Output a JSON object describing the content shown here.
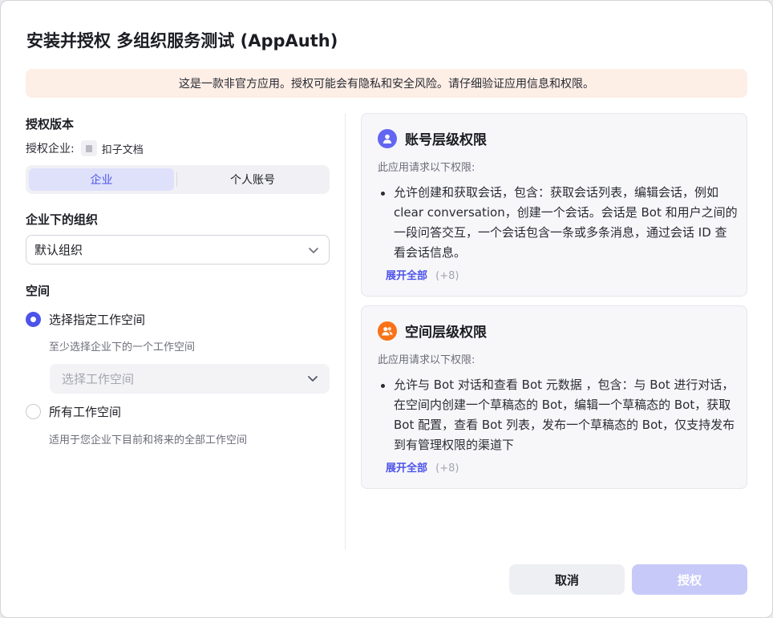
{
  "dialog": {
    "title": "安装并授权 多组织服务测试 (AppAuth)",
    "warning": "这是一款非官方应用。授权可能会有隐私和安全风险。请仔细验证应用信息和权限。"
  },
  "version": {
    "heading": "授权版本",
    "enterprise_label": "授权企业:",
    "enterprise_name": "扣子文档",
    "tabs": [
      {
        "label": "企业",
        "selected": true
      },
      {
        "label": "个人账号",
        "selected": false
      }
    ]
  },
  "organization": {
    "heading": "企业下的组织",
    "selected": "默认组织"
  },
  "space": {
    "heading": "空间",
    "options": [
      {
        "label": "选择指定工作空间",
        "hint": "至少选择企业下的一个工作空间",
        "checked": true
      },
      {
        "label": "所有工作空间",
        "hint": "适用于您企业下目前和将来的全部工作空间",
        "checked": false
      }
    ],
    "workspace_placeholder": "选择工作空间"
  },
  "permissions": [
    {
      "title": "账号层级权限",
      "subtitle": "此应用请求以下权限:",
      "items": [
        "允许创建和获取会话，包含：获取会话列表，编辑会话，例如 clear conversation，创建一个会话。会话是 Bot 和用户之间的一段问答交互，一个会话包含一条或多条消息，通过会话 ID 查看会话信息。"
      ],
      "expand_label": "展开全部",
      "more_count": "(+8)",
      "icon": "user-icon",
      "color": "#6366f1"
    },
    {
      "title": "空间层级权限",
      "subtitle": "此应用请求以下权限:",
      "items": [
        "允许与 Bot 对话和查看 Bot 元数据 ，包含：与 Bot 进行对话，在空间内创建一个草稿态的 Bot，编辑一个草稿态的 Bot，获取 Bot 配置，查看 Bot 列表，发布一个草稿态的 Bot，仅支持发布到有管理权限的渠道下"
      ],
      "expand_label": "展开全部",
      "more_count": "(+8)",
      "icon": "users-icon",
      "color": "#f97316"
    }
  ],
  "footer": {
    "cancel_label": "取消",
    "confirm_label": "授权"
  },
  "colors": {
    "accent": "#4d53e8",
    "warning_bg": "#fdeee6",
    "confirm_disabled": "#c7caf8"
  }
}
